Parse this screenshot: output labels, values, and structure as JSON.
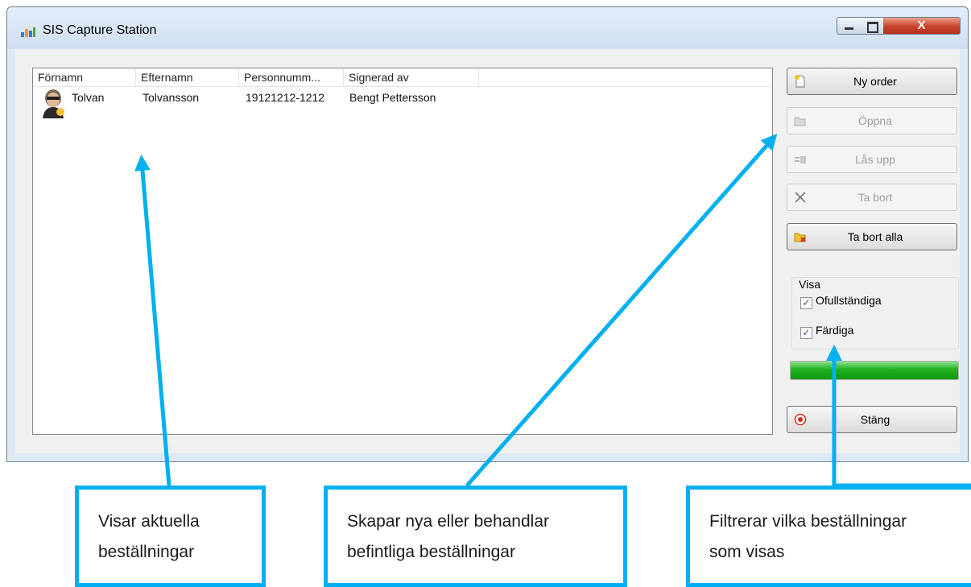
{
  "window": {
    "title": "SIS Capture Station",
    "close_symbol": "X"
  },
  "list": {
    "columns": [
      "Förnamn",
      "Efternamn",
      "Personnumm...",
      "Signerad av"
    ],
    "rows": [
      {
        "fornamn": "Tolvan",
        "efternamn": "Tolvansson",
        "personnummer": "19121212-1212",
        "signerad_av": "Bengt Pettersson",
        "icon": "patient-avatar-icon"
      }
    ]
  },
  "buttons": {
    "ny_order": "Ny order",
    "oppna": "Öppna",
    "las_upp": "Lås upp",
    "ta_bort": "Ta bort",
    "ta_bort_alla": "Ta bort alla",
    "stang": "Stäng"
  },
  "filter": {
    "title": "Visa",
    "ofullstandiga": {
      "label": "Ofullständiga",
      "checked": true
    },
    "fardiga": {
      "label": "Färdiga",
      "checked": true
    }
  },
  "progress": {
    "value": 1.0,
    "color": "#1fb01f"
  },
  "annotations": {
    "left": [
      "Visar aktuella",
      "beställningar"
    ],
    "middle": [
      "Skapar nya eller behandlar",
      "befintliga beställningar"
    ],
    "right": [
      "Filtrerar vilka beställningar",
      "som visas"
    ],
    "color": "#00b0f0"
  }
}
